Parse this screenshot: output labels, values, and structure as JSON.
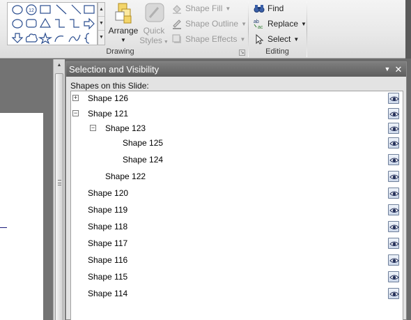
{
  "ribbon": {
    "drawing_group_label": "Drawing",
    "editing_group_label": "Editing",
    "arrange_label": "Arrange",
    "quick_styles_line1": "Quick",
    "quick_styles_line2": "Styles",
    "shape_fill_label": "Shape Fill",
    "shape_outline_label": "Shape Outline",
    "shape_effects_label": "Shape Effects",
    "find_label": "Find",
    "replace_label": "Replace",
    "select_label": "Select",
    "gallery_shape_12_label": "12",
    "accent_color": "#5f5f5f"
  },
  "pane": {
    "title": "Selection and Visibility",
    "subtitle": "Shapes on this Slide:",
    "menu_icon": "dropdown-arrow-icon",
    "close_icon": "close-icon",
    "items": [
      {
        "label": "Shape 126",
        "toggle": "+",
        "level": 0
      },
      {
        "label": "Shape 121",
        "toggle": "−",
        "level": 0
      },
      {
        "label": "Shape 123",
        "toggle": "−",
        "level": 1
      },
      {
        "label": "Shape 125",
        "toggle": "",
        "level": 2
      },
      {
        "label": "Shape 124",
        "toggle": "",
        "level": 2
      },
      {
        "label": "Shape 122",
        "toggle": "",
        "level": 1
      },
      {
        "label": "Shape 120",
        "toggle": "",
        "level": 0
      },
      {
        "label": "Shape 119",
        "toggle": "",
        "level": 0
      },
      {
        "label": "Shape 118",
        "toggle": "",
        "level": 0
      },
      {
        "label": "Shape 117",
        "toggle": "",
        "level": 0
      },
      {
        "label": "Shape 116",
        "toggle": "",
        "level": 0
      },
      {
        "label": "Shape 115",
        "toggle": "",
        "level": 0
      },
      {
        "label": "Shape 114",
        "toggle": "",
        "level": 0
      }
    ]
  }
}
